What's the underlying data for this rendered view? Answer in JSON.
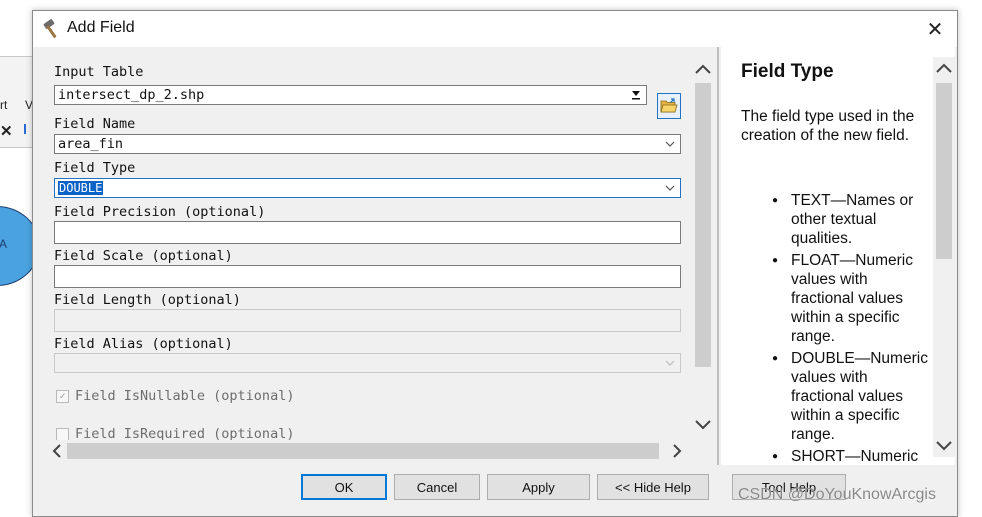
{
  "background": {
    "menu_fragment_1": "rt",
    "menu_fragment_2": "V",
    "toolbar_fragment": "✕",
    "circle_label": "A"
  },
  "dialog": {
    "title": "Add Field",
    "close_glyph": "✕"
  },
  "form": {
    "input_table": {
      "label": "Input Table",
      "value": "intersect_dp_2.shp"
    },
    "field_name": {
      "label": "Field Name",
      "value": "area_fin"
    },
    "field_type": {
      "label": "Field Type",
      "value": "DOUBLE"
    },
    "field_precision": {
      "label": "Field Precision (optional)",
      "value": ""
    },
    "field_scale": {
      "label": "Field Scale (optional)",
      "value": ""
    },
    "field_length": {
      "label": "Field Length (optional)",
      "value": ""
    },
    "field_alias": {
      "label": "Field Alias (optional)",
      "value": ""
    },
    "field_is_nullable": {
      "label": "Field IsNullable (optional)",
      "checked": true
    },
    "field_is_required": {
      "label": "Field IsRequired (optional)",
      "checked": false
    }
  },
  "help": {
    "title": "Field Type",
    "description": "The field type used in the creation of the new field.",
    "items": [
      "TEXT—Names or other textual qualities.",
      "FLOAT—Numeric values with fractional values within a specific range.",
      "DOUBLE—Numeric values with fractional values within a specific range.",
      "SHORT—Numeric"
    ]
  },
  "buttons": {
    "ok": "OK",
    "cancel": "Cancel",
    "apply": "Apply",
    "hide_help": "<< Hide Help",
    "tool_help": "Tool Help"
  },
  "watermark": "CSDN @DoYouKnowArcgis",
  "icons": {
    "title": "hammer-icon",
    "browse": "folder-open-icon"
  },
  "colors": {
    "selection": "#0a64c8",
    "default_button_border": "#0078d7",
    "circle_fill": "#4aa3e0"
  }
}
